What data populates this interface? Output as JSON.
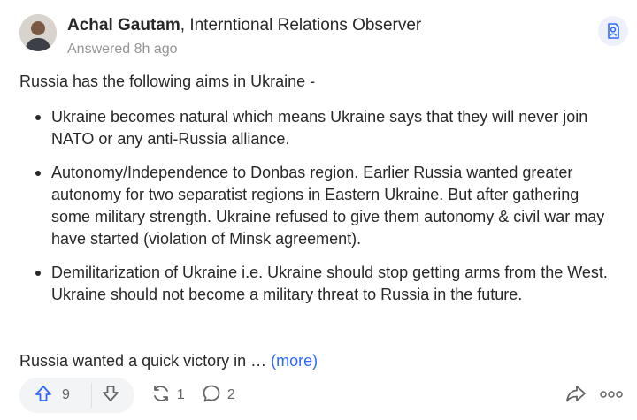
{
  "answer": {
    "author": {
      "name": "Achal Gautam",
      "separator": ", ",
      "credential": "Interntional Relations Observer",
      "answered_time": "Answered 8h ago"
    },
    "intro": "Russia has the following aims in Ukraine -",
    "aims": [
      "Ukraine becomes natural which means Ukraine says that they will never join NATO or any anti-Russia alliance.",
      "Autonomy/Independence to Donbas region. Earlier Russia wanted greater autonomy for two separatist regions in Eastern Ukraine. But after gathering some military strength. Ukraine refused to give them autonomy & civil war may have started (violation of Minsk agreement).",
      "Demilitarization of Ukraine i.e. Ukraine should stop getting arms from the West. Ukraine should not become a military threat to Russia in the future."
    ],
    "teaser": "Russia wanted a quick victory in … ",
    "more_label": "(more)"
  },
  "actions": {
    "upvotes": "9",
    "shares": "1",
    "comments": "2"
  },
  "icons": {
    "badge": "profile-badge-icon",
    "upvote": "arrow-up-icon",
    "downvote": "arrow-down-icon",
    "share": "reshare-icon",
    "comment": "comment-icon",
    "forward": "share-arrow-icon",
    "more": "more-dots-icon"
  },
  "colors": {
    "link": "#2e69ff",
    "upvote": "#2e69ff",
    "text": "#282829",
    "muted": "#939598",
    "badge_bg": "#eef1fb"
  }
}
